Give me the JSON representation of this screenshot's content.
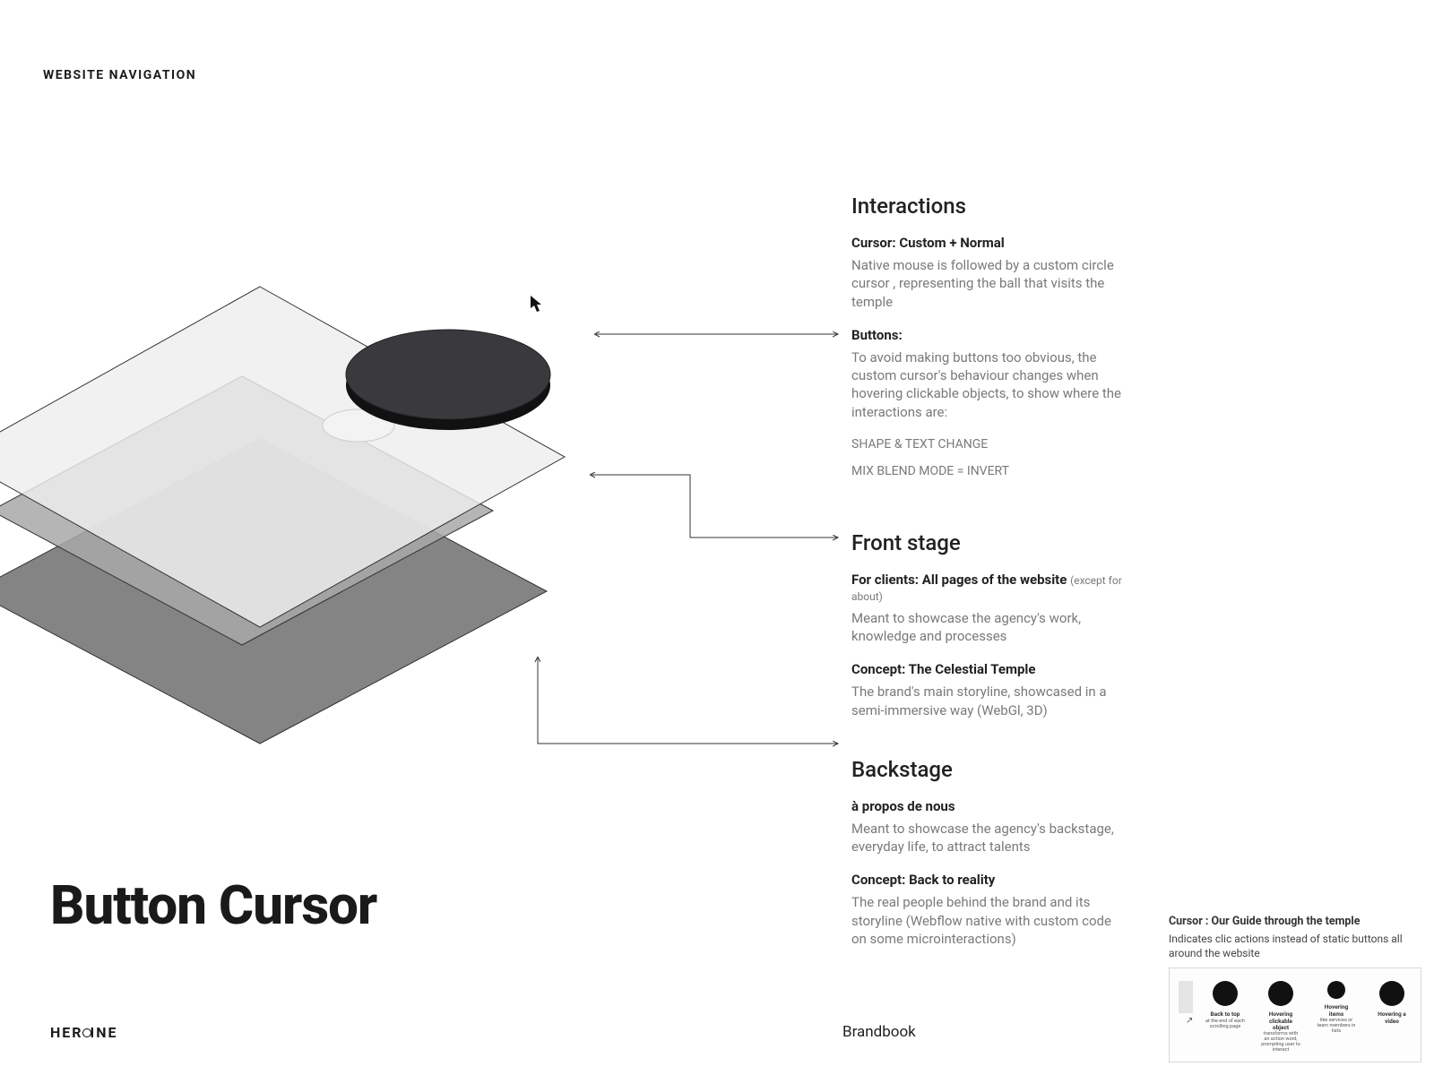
{
  "header": {
    "breadcrumb": "WEBSITE NAVIGATION"
  },
  "title": "Button Cursor",
  "footer": {
    "brand": "HEROINE",
    "doc": "Brandbook"
  },
  "sections": {
    "interactions": {
      "title": "Interactions",
      "cursor_label": "Cursor: Custom + Normal",
      "cursor_body": "Native mouse is followed by a custom circle cursor , representing the ball that visits the temple",
      "buttons_label": "Buttons:",
      "buttons_body": "To avoid making buttons too obvious, the custom cursor's behaviour changes when hovering clickable objects, to show where the interactions are:",
      "note1": "SHAPE & TEXT CHANGE",
      "note2": "MIX BLEND MODE = INVERT"
    },
    "frontstage": {
      "title": "Front stage",
      "clients_label": "For clients: All pages of the website",
      "clients_suffix": "(except for about)",
      "clients_body": "Meant to showcase the agency's work, knowledge and processes",
      "concept_label": "Concept: The Celestial Temple",
      "concept_body": "The brand's main storyline, showcased in a semi-immersive way (WebGl, 3D)"
    },
    "backstage": {
      "title": "Backstage",
      "about_label": "à propos de nous",
      "about_body": "Meant to showcase the agency's backstage, everyday life, to attract talents",
      "concept_label": "Concept: Back to reality",
      "concept_body": "The real people behind the brand and its storyline (Webflow native with custom code on some microinteractions)"
    }
  },
  "sidecard": {
    "title": "Cursor : Our Guide through the temple",
    "body": "Indicates clic actions instead of static buttons all around the website",
    "items": [
      {
        "cap": "Back to top",
        "sub": "at the end of each scrolling page"
      },
      {
        "cap": "Hovering clickable object",
        "sub": "transforms with an action word, prompting user to interact"
      },
      {
        "cap": "Hovering items",
        "sub": "like services or team members in lists"
      },
      {
        "cap": "Hovering a video",
        "sub": ""
      }
    ]
  }
}
